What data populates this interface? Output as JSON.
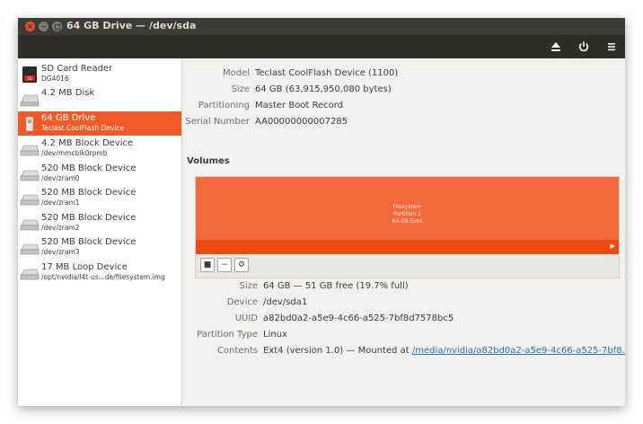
{
  "window": {
    "title": "64 GB Drive — /dev/sda"
  },
  "toolbar": {
    "buttons": [
      {
        "name": "eject",
        "icon": "eject-icon"
      },
      {
        "name": "power",
        "icon": "power-icon"
      },
      {
        "name": "menu",
        "icon": "hamburger-menu-icon"
      }
    ]
  },
  "sidebar": {
    "items": [
      {
        "name": "SD Card Reader",
        "sub": "DG4016",
        "icon": "sd-card-icon"
      },
      {
        "name": "4.2 MB Disk",
        "sub": "",
        "icon": "disk-icon"
      },
      {
        "name": "64 GB Drive",
        "sub": "Teclast CoolFlash Device",
        "icon": "usb-drive-icon",
        "selected": true
      },
      {
        "name": "4.2 MB Block Device",
        "sub": "/dev/mmcblk0rpmb",
        "icon": "block-device-icon"
      },
      {
        "name": "520 MB Block Device",
        "sub": "/dev/zram0",
        "icon": "block-device-icon"
      },
      {
        "name": "520 MB Block Device",
        "sub": "/dev/zram1",
        "icon": "block-device-icon"
      },
      {
        "name": "520 MB Block Device",
        "sub": "/dev/zram2",
        "icon": "block-device-icon"
      },
      {
        "name": "520 MB Block Device",
        "sub": "/dev/zram3",
        "icon": "block-device-icon"
      },
      {
        "name": "17 MB Loop Device",
        "sub": "/opt/nvidia/l4t-us...de/filesystem.img",
        "icon": "block-device-icon"
      }
    ]
  },
  "drive": {
    "model_label": "Model",
    "model": "Teclast CoolFlash Device (1100)",
    "size_label": "Size",
    "size": "64 GB (63,915,950,080 bytes)",
    "partitioning_label": "Partitioning",
    "partitioning": "Master Boot Record",
    "serial_label": "Serial Number",
    "serial": "AA00000000007285"
  },
  "volumes": {
    "heading": "Volumes",
    "partition": {
      "line1": "Filesystem",
      "line2": "Partition 1",
      "line3": "64 GB Ext4"
    },
    "buttons": [
      {
        "name": "stop",
        "glyph": "■"
      },
      {
        "name": "minus",
        "glyph": "−"
      },
      {
        "name": "settings",
        "glyph": "⚙"
      }
    ],
    "colors": {
      "partition": "#f26a3b",
      "partition_selected_strip": "#ea4c12"
    }
  },
  "partition_details": {
    "size_label": "Size",
    "size": "64 GB — 51 GB free (19.7% full)",
    "device_label": "Device",
    "device": "/dev/sda1",
    "uuid_label": "UUID",
    "uuid": "a82bd0a2-a5e9-4c66-a525-7bf8d7578bc5",
    "type_label": "Partition Type",
    "type": "Linux",
    "contents_label": "Contents",
    "contents_prefix": "Ext4 (version 1.0) — Mounted at ",
    "mount_link": "/media/nvidia/a82bd0a2-a5e9-4c66-a525-7bf8..."
  }
}
